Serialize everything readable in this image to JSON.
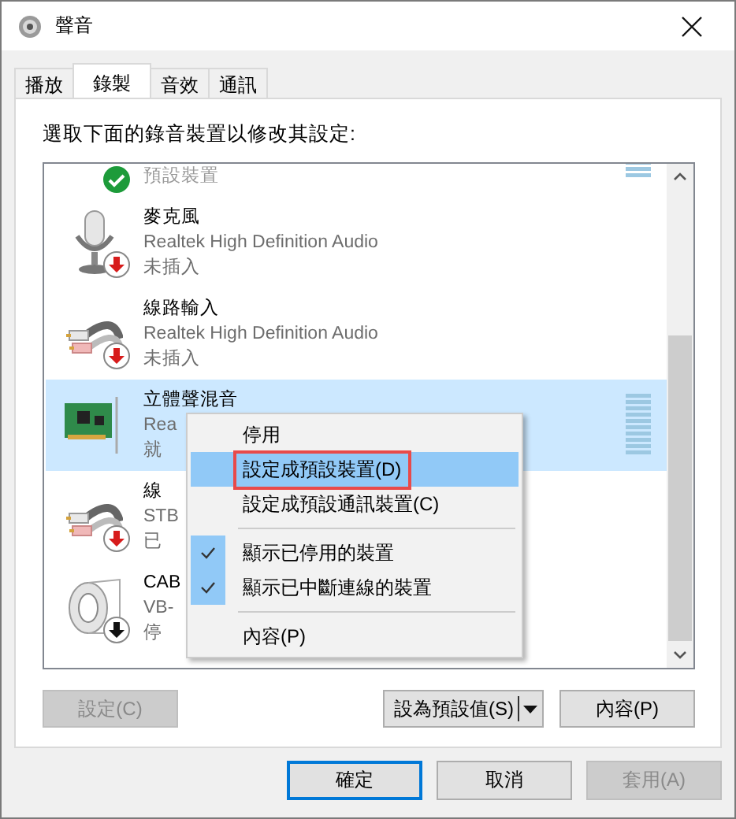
{
  "window": {
    "title": "聲音"
  },
  "tabs": [
    {
      "label": "播放",
      "selected": false
    },
    {
      "label": "錄製",
      "selected": true
    },
    {
      "label": "音效",
      "selected": false
    },
    {
      "label": "通訊",
      "selected": false
    }
  ],
  "instruction": "選取下面的錄音裝置以修改其設定:",
  "devices": [
    {
      "default": true,
      "unplugged": false,
      "disabled": false,
      "status": "預設裝置",
      "meter": true,
      "selected": false
    },
    {
      "default": false,
      "unplugged": true,
      "disabled": false,
      "name": "麥克風",
      "driver": "Realtek High Definition Audio",
      "status": "未插入",
      "meter": false,
      "selected": false
    },
    {
      "default": false,
      "unplugged": true,
      "disabled": false,
      "name": "線路輸入",
      "driver": "Realtek High Definition Audio",
      "status": "未插入",
      "meter": false,
      "selected": false
    },
    {
      "default": false,
      "unplugged": false,
      "disabled": false,
      "name": "立體聲混音",
      "driver": "Rea",
      "status": "就",
      "meter": true,
      "selected": true
    },
    {
      "default": false,
      "unplugged": true,
      "disabled": false,
      "name": "線",
      "driver": "STB",
      "status": "已",
      "meter": false,
      "selected": false
    },
    {
      "default": false,
      "unplugged": false,
      "disabled": true,
      "name": "CAB",
      "driver": "VB-",
      "status": "停",
      "meter": false,
      "selected": false
    }
  ],
  "context_menu": [
    {
      "kind": "item",
      "label": "停用",
      "checked": false,
      "selected": false
    },
    {
      "kind": "item",
      "label": "設定成預設裝置(D)",
      "checked": false,
      "selected": true
    },
    {
      "kind": "item",
      "label": "設定成預設通訊裝置(C)",
      "checked": false,
      "selected": false
    },
    {
      "kind": "separator"
    },
    {
      "kind": "item",
      "label": "顯示已停用的裝置",
      "checked": true,
      "selected": false
    },
    {
      "kind": "item",
      "label": "顯示已中斷連線的裝置",
      "checked": true,
      "selected": false
    },
    {
      "kind": "separator"
    },
    {
      "kind": "item",
      "label": "內容(P)",
      "checked": false,
      "selected": false
    }
  ],
  "selection_callout": {
    "kind": "outline"
  },
  "configure_button": {
    "label": "設定(C)",
    "disabled": true
  },
  "set_default_button": {
    "label": "設為預設值(S)",
    "disabled": false
  },
  "properties_button": {
    "label": "內容(P)",
    "disabled": false
  },
  "dialog_buttons": [
    {
      "label": "確定",
      "default": true,
      "disabled": false
    },
    {
      "label": "取消",
      "default": false,
      "disabled": false
    },
    {
      "label": "套用(A)",
      "default": false,
      "disabled": true
    }
  ]
}
